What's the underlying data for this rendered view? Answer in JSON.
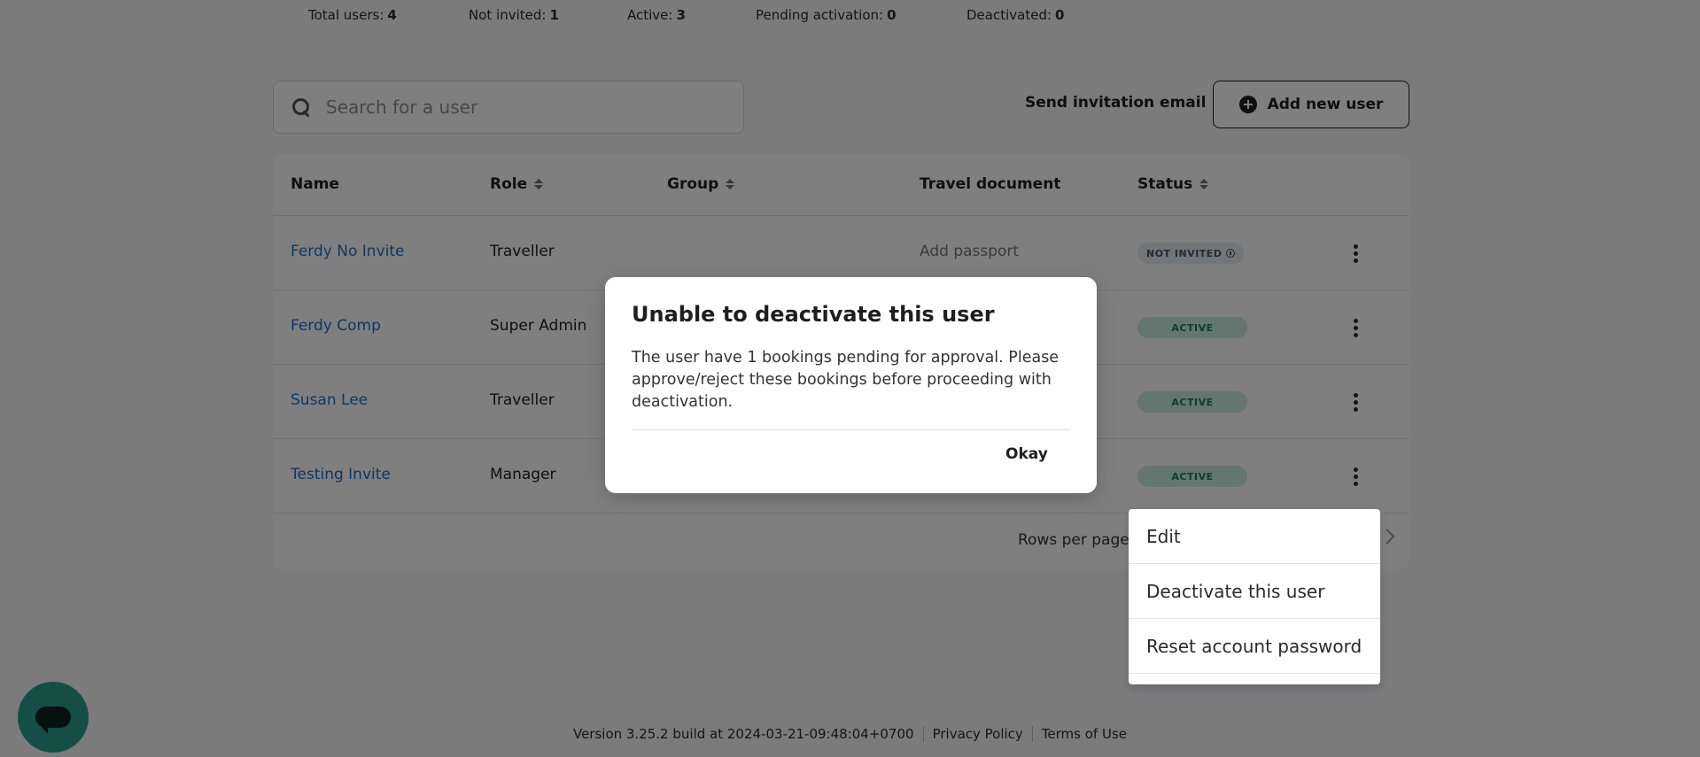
{
  "stats": [
    {
      "label": "Total users:",
      "value": "4"
    },
    {
      "label": "Not invited:",
      "value": "1"
    },
    {
      "label": "Active:",
      "value": "3"
    },
    {
      "label": "Pending activation:",
      "value": "0"
    },
    {
      "label": "Deactivated:",
      "value": "0"
    }
  ],
  "search": {
    "placeholder": "Search for a user"
  },
  "actions": {
    "send_invite": "Send invitation email",
    "add_user": "Add new user"
  },
  "table": {
    "headers": [
      "Name",
      "Role",
      "Group",
      "Travel document",
      "Status"
    ],
    "rows": [
      {
        "name": "Ferdy No Invite",
        "role": "Traveller",
        "group": "",
        "travel_document": "Add passport",
        "status": "NOT INVITED"
      },
      {
        "name": "Ferdy Comp",
        "role": "Super Admin",
        "group": "",
        "travel_document": "",
        "status": "ACTIVE"
      },
      {
        "name": "Susan Lee",
        "role": "Traveller",
        "group": "",
        "travel_document": "",
        "status": "ACTIVE"
      },
      {
        "name": "Testing Invite",
        "role": "Manager",
        "group": "",
        "travel_document": "",
        "status": "ACTIVE"
      }
    ],
    "rows_per_page_label": "Rows per page"
  },
  "menu": {
    "items": [
      "Edit",
      "Deactivate this user",
      "Reset account password"
    ]
  },
  "modal": {
    "title": "Unable to deactivate this user",
    "body": "The user have 1 bookings pending for approval. Please approve/reject these bookings before proceeding with deactivation.",
    "ok_label": "Okay"
  },
  "footer": {
    "version": "Version 3.25.2 build at 2024-03-21-09:48:04+0700",
    "privacy": "Privacy Policy",
    "terms": "Terms of Use"
  },
  "colors": {
    "link": "#1f6ec2",
    "active_badge_bg": "#c9ece0",
    "chat_button": "#2a9d8f"
  }
}
